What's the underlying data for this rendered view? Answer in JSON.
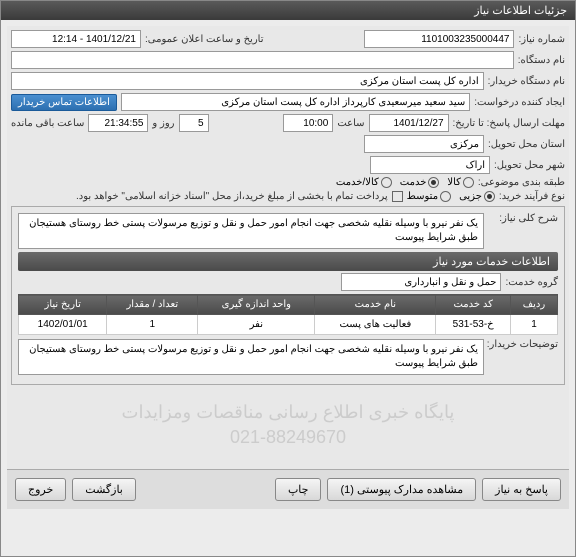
{
  "window_title": "جزئیات اطلاعات نیاز",
  "form": {
    "need_number_label": "شماره نیاز:",
    "need_number": "1101003235000447",
    "announce_label": "تاریخ و ساعت اعلان عمومی:",
    "announce_value": "1401/12/21 - 12:14",
    "device_label": "نام دستگاه:",
    "device_value": "",
    "buyer_label": "نام دستگاه خریدار:",
    "buyer_value": "اداره کل پست استان مرکزی",
    "requester_label": "ایجاد کننده درخواست:",
    "requester_value": "سید سعید میرسعیدی کارپرداز اداره کل پست استان مرکزی",
    "contact_btn": "اطلاعات تماس خریدار",
    "deadline_label": "مهلت ارسال پاسخ: تا تاریخ:",
    "deadline_date": "1401/12/27",
    "time_label": "ساعت",
    "deadline_time": "10:00",
    "day_label": "روز و",
    "days": "5",
    "remain_time": "21:34:55",
    "remain_label": "ساعت باقی مانده",
    "delivery_state_label": "استان محل تحویل:",
    "delivery_state": "مرکزی",
    "delivery_city_label": "شهر محل تحویل:",
    "delivery_city": "اراک",
    "subject_class_label": "طبقه بندی موضوعی:",
    "radio_kala": "کالا",
    "radio_khedmat": "خدمت",
    "radio_kala_khedmat": "کالا/خدمت",
    "purchase_type_label": "نوع فرآیند خرید:",
    "radio_jozi": "جزیی",
    "radio_motavaset": "متوسط",
    "purchase_note": "پرداخت تمام با بخشی از مبلغ خرید،از محل \"اسناد خزانه اسلامی\" خواهد بود.",
    "desc_label": "شرح کلی نیاز:",
    "desc_text": "یک نفر نیرو با وسیله نقلیه شخصی جهت انجام امور حمل و نقل و توزیع مرسولات پستی خط روستای هستیجان  طبق شرایط پیوست",
    "services_header": "اطلاعات خدمات مورد نیاز",
    "service_group_label": "گروه خدمت:",
    "service_group": "حمل و نقل و انبارداری",
    "buyer_notes_label": "توضیحات خریدار:",
    "buyer_notes": "یک نفر نیرو با وسیله نقلیه شخصی جهت انجام امور حمل و نقل و توزیع مرسولات پستی خط روستای هستیجان  طبق شرایط پیوست"
  },
  "table": {
    "headers": [
      "ردیف",
      "کد خدمت",
      "نام خدمت",
      "واحد اندازه گیری",
      "تعداد / مقدار",
      "تاریخ نیاز"
    ],
    "row": [
      "1",
      "خ-53-531",
      "فعالیت های پست",
      "نفر",
      "1",
      "1402/01/01"
    ]
  },
  "watermark": {
    "line1": "پایگاه خبری اطلاع رسانی مناقصات ومزایدات",
    "line2": "021-88249670"
  },
  "buttons": {
    "respond": "پاسخ به نیاز",
    "attachments": "مشاهده مدارک پیوستی (1)",
    "print": "چاپ",
    "back": "بازگشت",
    "exit": "خروج"
  }
}
